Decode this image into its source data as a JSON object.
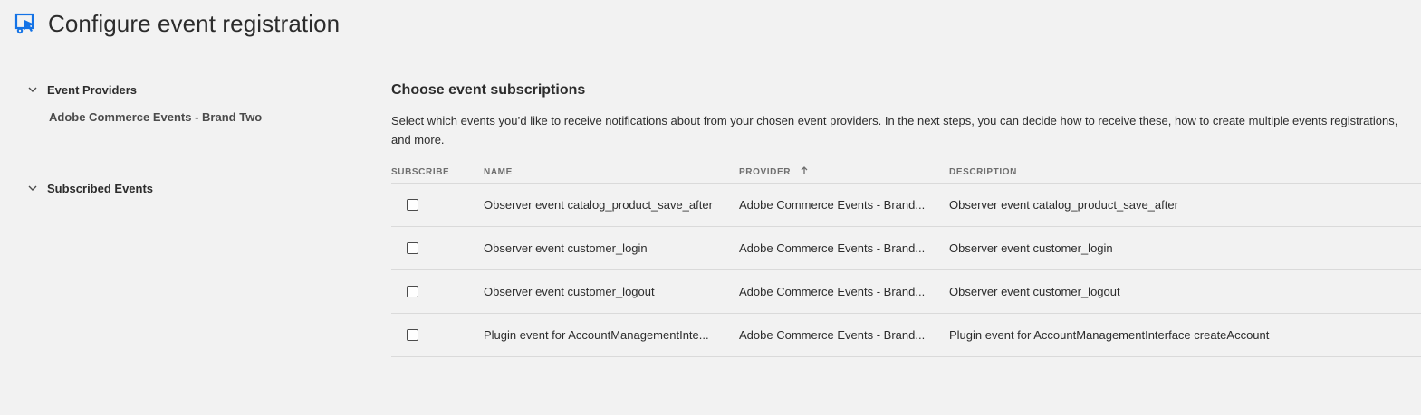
{
  "header": {
    "title": "Configure event registration",
    "icon": "event-registration-icon",
    "accent_color": "#1473e6"
  },
  "sidebar": {
    "groups": [
      {
        "title": "Event Providers",
        "icon": "chevron-down-icon",
        "items": [
          "Adobe Commerce Events - Brand Two"
        ]
      },
      {
        "title": "Subscribed Events",
        "icon": "chevron-down-icon",
        "items": []
      }
    ]
  },
  "main": {
    "title": "Choose event subscriptions",
    "description": "Select which events you’d like to receive notifications about from your chosen event providers. In the next steps, you can decide how to receive these, how to create multiple events registrations, and more.",
    "table": {
      "columns": [
        "SUBSCRIBE",
        "NAME",
        "PROVIDER",
        "DESCRIPTION"
      ],
      "sort_icon": "arrow-up-icon",
      "rows": [
        {
          "subscribed": false,
          "name": "Observer event catalog_product_save_after",
          "provider": "Adobe Commerce Events - Brand...",
          "description": "Observer event catalog_product_save_after"
        },
        {
          "subscribed": false,
          "name": "Observer event customer_login",
          "provider": "Adobe Commerce Events - Brand...",
          "description": "Observer event customer_login"
        },
        {
          "subscribed": false,
          "name": "Observer event customer_logout",
          "provider": "Adobe Commerce Events - Brand...",
          "description": "Observer event customer_logout"
        },
        {
          "subscribed": false,
          "name": "Plugin event for AccountManagementInte...",
          "provider": "Adobe Commerce Events - Brand...",
          "description": "Plugin event for AccountManagementInterface createAccount"
        }
      ]
    }
  }
}
